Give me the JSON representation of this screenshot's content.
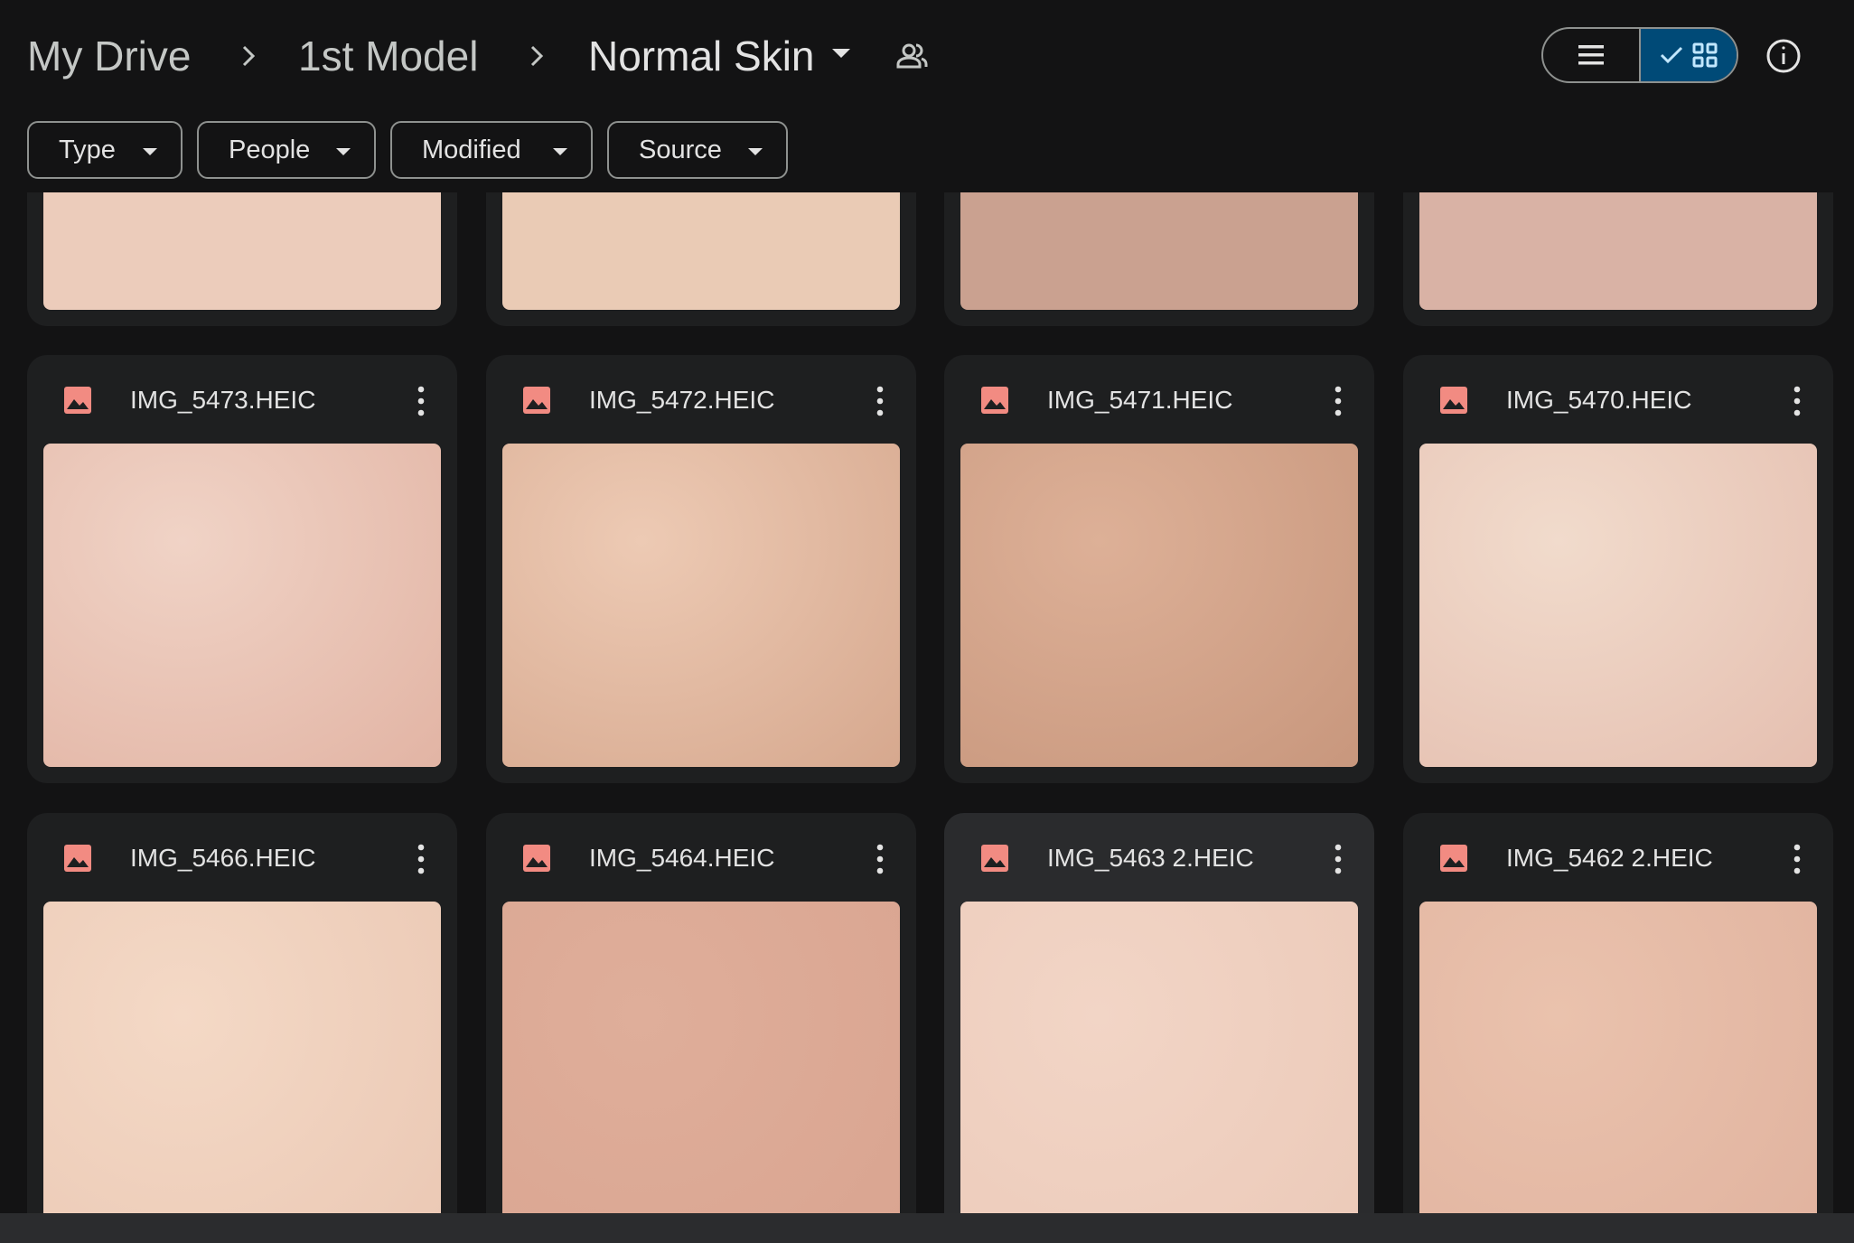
{
  "breadcrumb": {
    "items": [
      "My Drive",
      "1st Model",
      "Normal Skin"
    ]
  },
  "filters": [
    "Type",
    "People",
    "Modified",
    "Source"
  ],
  "view": {
    "mode": "grid",
    "selected_icon": "check-icon"
  },
  "top_row_thumbs": [
    "#ecccbb",
    "#eacbb5",
    "#caa190",
    "#d9b2a5"
  ],
  "rows": [
    [
      {
        "name": "IMG_5473.HEIC",
        "colors": [
          "#f0d3c6",
          "#e2b4a4"
        ]
      },
      {
        "name": "IMG_5472.HEIC",
        "colors": [
          "#edcab4",
          "#d6a88e"
        ]
      },
      {
        "name": "IMG_5471.HEIC",
        "colors": [
          "#ddb097",
          "#c8977d"
        ]
      },
      {
        "name": "IMG_5470.HEIC",
        "colors": [
          "#f1dbcc",
          "#e5bfb0"
        ]
      }
    ],
    [
      {
        "name": "IMG_5466.HEIC",
        "colors": [
          "#f4d9c6",
          "#eac7b3"
        ]
      },
      {
        "name": "IMG_5464.HEIC",
        "colors": [
          "#dfae9a",
          "#d9a490"
        ]
      },
      {
        "name": "IMG_5463 2.HEIC",
        "colors": [
          "#f2d5c6",
          "#ebc9b8"
        ],
        "hover": true
      },
      {
        "name": "IMG_5462 2.HEIC",
        "colors": [
          "#eac2ad",
          "#e0b29e"
        ]
      }
    ]
  ],
  "colors": {
    "image_icon": "#f28b82",
    "accent_selected": "#004a77",
    "background": "#131314"
  }
}
